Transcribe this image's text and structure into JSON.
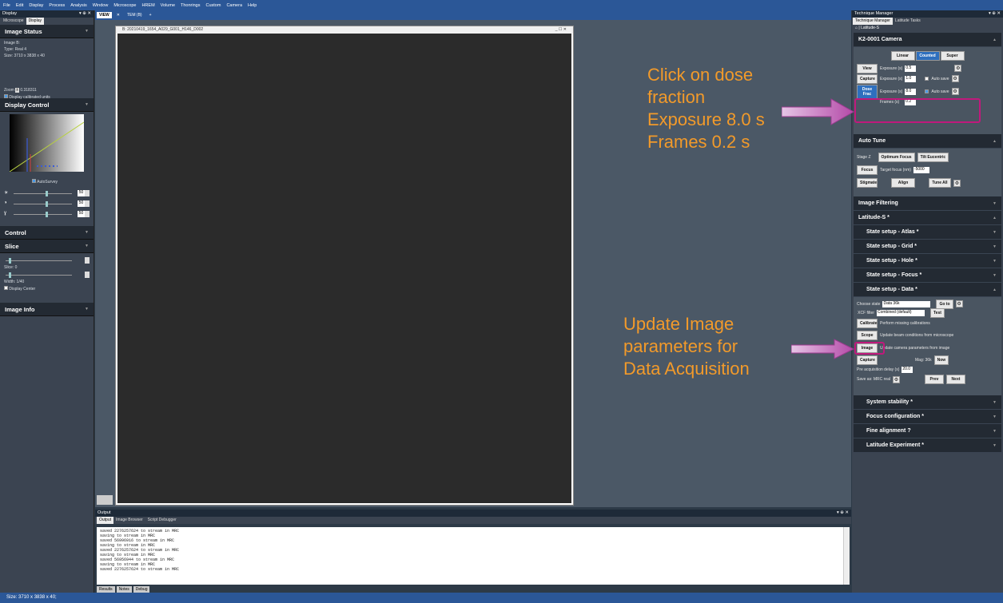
{
  "menu": [
    "File",
    "Edit",
    "Display",
    "Process",
    "Analysis",
    "Window",
    "Microscope",
    "HREM",
    "Volume",
    "Thonrings",
    "Custom",
    "Camera",
    "Help"
  ],
  "left_panel": {
    "title": "Display",
    "tabs": [
      "Microscope",
      "Display"
    ],
    "image_status": {
      "header": "Image Status",
      "lines": [
        "Image B:",
        "Type:  Real 4",
        "Size:  3710 x 3838 x 40"
      ],
      "zoom_label": "Zoom",
      "zoom_value": "0.318311",
      "calibrated_label": "Display calibrated units"
    },
    "display_control": {
      "header": "Display Control",
      "autosurvey": "AutoSurvey",
      "slider_values": [
        "50",
        "50",
        "50"
      ]
    },
    "control_header": "Control",
    "slice": {
      "header": "Slice",
      "slice_label": "Slice: 0",
      "width_label": "Width: 1/40",
      "display_center": "Display Center"
    },
    "image_info_header": "Image Info"
  },
  "view_tabs": [
    "VIEW",
    "TEM (B)"
  ],
  "image_window": {
    "title": "B: 20210419_1654_A029_G001_H146_D002"
  },
  "output": {
    "title": "Output",
    "tabs": [
      "Output",
      "Image Browser",
      "Script Debugger"
    ],
    "lines": [
      "saved 2276257624 to stream in MRC",
      "saving to stream in MRC",
      "saved 56996916 to stream in MRC",
      "saving to stream in MRC",
      "saved 2276257624 to stream in MRC",
      "saving to stream in MRC",
      "saved 56956944 to stream in MRC",
      "saving to stream in MRC",
      "saved 2276257624 to stream in MRC"
    ],
    "bottom_tabs": [
      "Results",
      "Notes",
      "Debug"
    ]
  },
  "status": "Size: 3710 x 3838 x 40;",
  "right_panel": {
    "title": "Technique Manager",
    "tabs": [
      "Technique Manager",
      "Latitude Tasks"
    ],
    "breadcrumb": "Latitude-S",
    "camera": {
      "header": "K2-0001 Camera",
      "modes": [
        "Linear",
        "Counted",
        "Super"
      ],
      "view_btn": "View",
      "capture_btn": "Capture",
      "dosefrac_btn": "Dose Frac",
      "exposure_label": "Exposure (s)",
      "frames_label": "Frames (s)",
      "autosave_label": "Auto save",
      "view_exposure": "0.5",
      "capture_exposure": "1.0",
      "dosefrac_exposure": "8.0",
      "frames": "0.2"
    },
    "autotune": {
      "header": "Auto Tune",
      "stage_label": "Stage Z",
      "optimum_focus": "Optimum Focus",
      "tilt_eucentric": "Tilt Eucentric",
      "focus_btn": "Focus",
      "target_focus_label": "Target focus (nm)",
      "target_focus": "-5000",
      "stigmate_btn": "Stigmate",
      "align_btn": "Align",
      "tune_all_btn": "Tune All"
    },
    "sections_a": [
      "Image Filtering",
      "Latitude-S *"
    ],
    "state_sections": [
      "State setup - Atlas *",
      "State setup - Grid *",
      "State setup - Hole *",
      "State setup - Focus *",
      "State setup - Data *"
    ],
    "data": {
      "choose_state_label": "Choose state",
      "choose_state": "Data 36k",
      "goto_btn": "Go to",
      "xcf_label": "XCF filter",
      "xcf_value": "Combined (default)",
      "test_btn": "Test",
      "calibrate_btn": "Calibrate",
      "calibrate_desc": "Perform missing calibrations",
      "scope_btn": "Scope",
      "scope_desc": "Update beam conditions from microscope",
      "image_btn": "Image",
      "image_desc": "Update camera parameters from image",
      "capture_btn": "Capture",
      "mag_label": "Mag: 36k",
      "now_btn": "Now",
      "preacq_label": "Pre acquisition delay (s)",
      "preacq_value": "20.0",
      "save_as": "Save as: MRC real",
      "prev_btn": "Prev",
      "next_btn": "Next"
    },
    "sections_b": [
      "System stability *",
      "Focus configuration *",
      "Fine alignment ?",
      "Latitude Experiment *"
    ]
  },
  "annotations": {
    "top": [
      "Click on dose",
      "fraction",
      "Exposure 8.0 s",
      "Frames 0.2 s"
    ],
    "bottom": [
      "Update Image",
      "parameters for",
      "Data Acquisition"
    ]
  },
  "colors": {
    "annotation": "#f29a2a",
    "highlight": "#c0197c",
    "arrow": "#b44aa8",
    "accent": "#2b5797"
  }
}
